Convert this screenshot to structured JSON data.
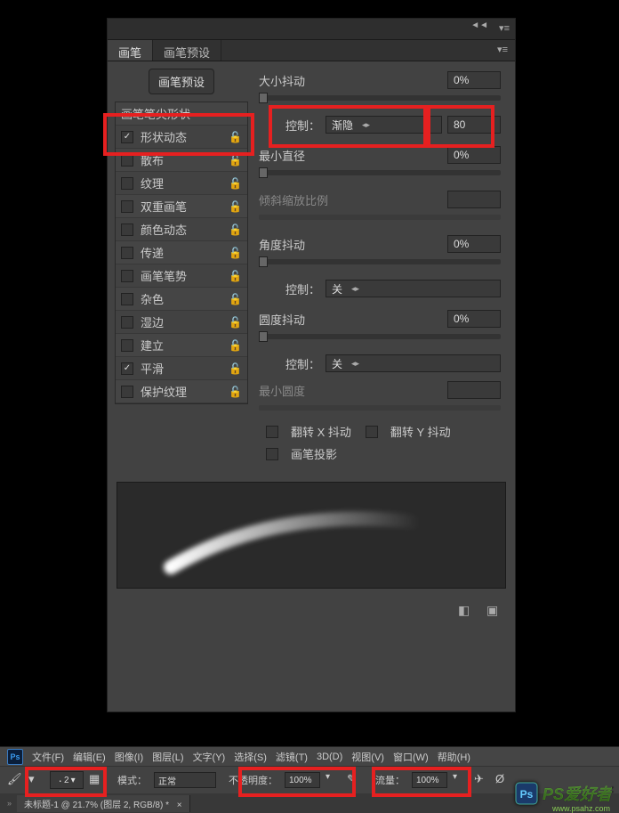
{
  "panel": {
    "tabs": {
      "brush": "画笔",
      "presets": "画笔预设"
    },
    "preset_button": "画笔预设",
    "options": [
      {
        "label": "画笔笔尖形状",
        "checked": true,
        "lock": false
      },
      {
        "label": "形状动态",
        "checked": true,
        "lock": true
      },
      {
        "label": "散布",
        "checked": false,
        "lock": true
      },
      {
        "label": "纹理",
        "checked": false,
        "lock": true
      },
      {
        "label": "双重画笔",
        "checked": false,
        "lock": true
      },
      {
        "label": "颜色动态",
        "checked": false,
        "lock": true
      },
      {
        "label": "传递",
        "checked": false,
        "lock": true
      },
      {
        "label": "画笔笔势",
        "checked": false,
        "lock": true
      },
      {
        "label": "杂色",
        "checked": false,
        "lock": true
      },
      {
        "label": "湿边",
        "checked": false,
        "lock": true
      },
      {
        "label": "建立",
        "checked": false,
        "lock": true
      },
      {
        "label": "平滑",
        "checked": true,
        "lock": true
      },
      {
        "label": "保护纹理",
        "checked": false,
        "lock": true
      }
    ],
    "controls": {
      "size_jitter": {
        "label": "大小抖动",
        "value": "0%"
      },
      "control1": {
        "label": "控制：",
        "option": "渐隐",
        "value": "80"
      },
      "min_diameter": {
        "label": "最小直径",
        "value": "0%"
      },
      "tilt_scale": {
        "label": "倾斜缩放比例",
        "value": ""
      },
      "angle_jitter": {
        "label": "角度抖动",
        "value": "0%"
      },
      "control2": {
        "label": "控制：",
        "option": "关"
      },
      "round_jitter": {
        "label": "圆度抖动",
        "value": "0%"
      },
      "control3": {
        "label": "控制：",
        "option": "关"
      },
      "min_round": {
        "label": "最小圆度",
        "value": ""
      },
      "flip_x": "翻转 X 抖动",
      "flip_y": "翻转 Y 抖动",
      "projection": "画笔投影"
    }
  },
  "menubar": {
    "items": [
      "文件(F)",
      "编辑(E)",
      "图像(I)",
      "图层(L)",
      "文字(Y)",
      "选择(S)",
      "滤镜(T)",
      "3D(D)",
      "视图(V)",
      "窗口(W)",
      "帮助(H)"
    ]
  },
  "optbar": {
    "brush_size": "2",
    "mode_label": "模式：",
    "mode_value": "正常",
    "opacity_label": "不透明度：",
    "opacity_value": "100%",
    "flow_label": "流量：",
    "flow_value": "100%"
  },
  "doc": {
    "title": "未标题-1 @ 21.7% (图层 2, RGB/8) *"
  },
  "watermark": {
    "text": "PS爱好者",
    "url": "www.psahz.com"
  }
}
